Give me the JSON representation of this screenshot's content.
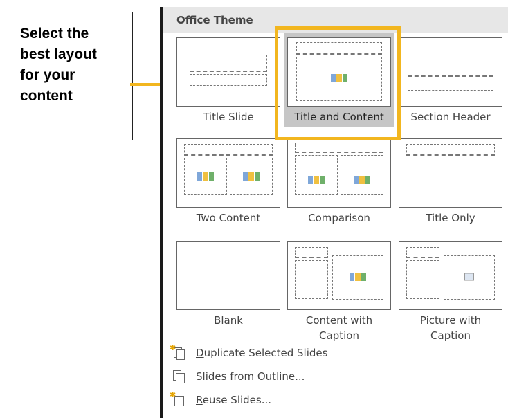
{
  "callout": {
    "lines": [
      "Select the",
      "best layout",
      "for your",
      "content"
    ]
  },
  "panel": {
    "header": "Office Theme",
    "selected_layout": "Title and Content",
    "layouts": [
      {
        "label": "Title Slide"
      },
      {
        "label": "Title and Content"
      },
      {
        "label": "Section Header"
      },
      {
        "label": "Two Content"
      },
      {
        "label": "Comparison"
      },
      {
        "label": "Title Only"
      },
      {
        "label": "Blank"
      },
      {
        "label": "Content with",
        "label2": "Caption"
      },
      {
        "label": "Picture with",
        "label2": "Caption"
      }
    ],
    "menu": [
      {
        "pre": "",
        "u": "D",
        "post": "uplicate Selected Slides",
        "icon": "duplicate-slides-icon"
      },
      {
        "pre": "Slides from Out",
        "u": "l",
        "post": "ine...",
        "icon": "slides-from-outline-icon"
      },
      {
        "pre": "",
        "u": "R",
        "post": "euse Slides...",
        "icon": "reuse-slides-icon"
      }
    ]
  },
  "colors": {
    "highlight": "#f2b61f",
    "selected_bg": "#c6c6c6"
  }
}
